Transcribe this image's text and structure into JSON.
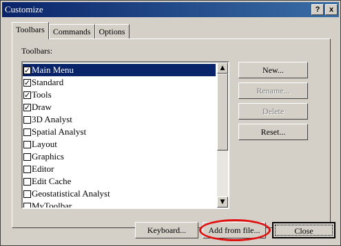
{
  "window": {
    "title": "Customize"
  },
  "title_buttons": {
    "help": "?",
    "close": "x"
  },
  "tabs": [
    {
      "label": "Toolbars",
      "active": true
    },
    {
      "label": "Commands",
      "active": false
    },
    {
      "label": "Options",
      "active": false
    }
  ],
  "toolbars_label": "Toolbars:",
  "toolbars": [
    {
      "label": "Main Menu",
      "checked": true,
      "selected": true
    },
    {
      "label": "Standard",
      "checked": true,
      "selected": false
    },
    {
      "label": "Tools",
      "checked": true,
      "selected": false
    },
    {
      "label": "Draw",
      "checked": true,
      "selected": false
    },
    {
      "label": "3D Analyst",
      "checked": false,
      "selected": false
    },
    {
      "label": "Spatial Analyst",
      "checked": false,
      "selected": false
    },
    {
      "label": "Layout",
      "checked": false,
      "selected": false
    },
    {
      "label": "Graphics",
      "checked": false,
      "selected": false
    },
    {
      "label": "Editor",
      "checked": false,
      "selected": false
    },
    {
      "label": "Edit Cache",
      "checked": false,
      "selected": false
    },
    {
      "label": "Geostatistical Analyst",
      "checked": false,
      "selected": false
    },
    {
      "label": "MyToolbar",
      "checked": false,
      "selected": false
    }
  ],
  "side_buttons": {
    "new": "New...",
    "rename": "Rename...",
    "delete": "Delete",
    "reset": "Reset..."
  },
  "bottom_buttons": {
    "keyboard": "Keyboard...",
    "add_from_file": "Add from file...",
    "close": "Close"
  },
  "colors": {
    "title_bar": "#0a246a",
    "selection": "#0a246a",
    "highlight_oval": "#e01010"
  }
}
